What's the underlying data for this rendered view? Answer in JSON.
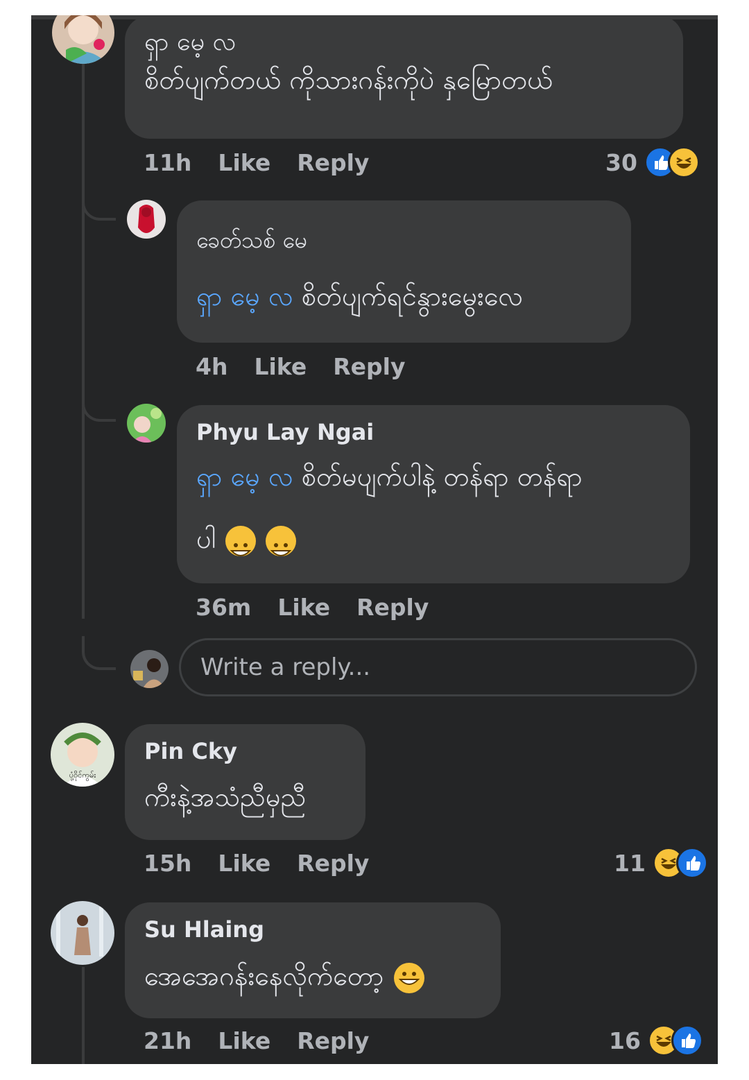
{
  "comments": [
    {
      "author": "ရှာ မေ့ လ",
      "text": "စိတ်ပျက်တယ် ကိုသားဂန်းကိုပဲ နှမြောတယ်",
      "time": "11h",
      "like": "Like",
      "reply": "Reply",
      "reaction_count": "30",
      "reactions": [
        "like-icon",
        "haha-icon"
      ]
    },
    {
      "author": "Pin Cky",
      "avatar_caption": "ပုံ့ဝိုင်ကွမ်း",
      "text": "ကီးနဲ့အသံညီမှညီ",
      "time": "15h",
      "like": "Like",
      "reply": "Reply",
      "reaction_count": "11",
      "reactions": [
        "haha-icon",
        "like-icon"
      ]
    },
    {
      "author": "Su Hlaing",
      "text": "အေအေဂန်းနေလိုက်တော့",
      "time": "21h",
      "like": "Like",
      "reply": "Reply",
      "reaction_count": "16",
      "reactions": [
        "haha-icon",
        "like-icon"
      ]
    }
  ],
  "replies": [
    {
      "author": "ခေတ်သစ် မေ",
      "mention": "ရှာ မေ့ လ",
      "text": "စိတ်ပျက်ရင်နွားမွေးလေ",
      "time": "4h",
      "like": "Like",
      "reply": "Reply"
    },
    {
      "author": "Phyu Lay Ngai",
      "mention": "ရှာ မေ့ လ",
      "text_line1": "စိတ်မပျက်ပါနဲ့ တန်ရာ တန်ရာ",
      "text_line2": "ပါ",
      "time": "36m",
      "like": "Like",
      "reply": "Reply"
    }
  ],
  "reply_box": {
    "placeholder": "Write a reply..."
  },
  "colors": {
    "background": "#242526",
    "bubble": "#3a3b3c",
    "mention": "#5aa7ff",
    "like_blue": "#1b74e4",
    "haha_yellow": "#f7c23a"
  }
}
